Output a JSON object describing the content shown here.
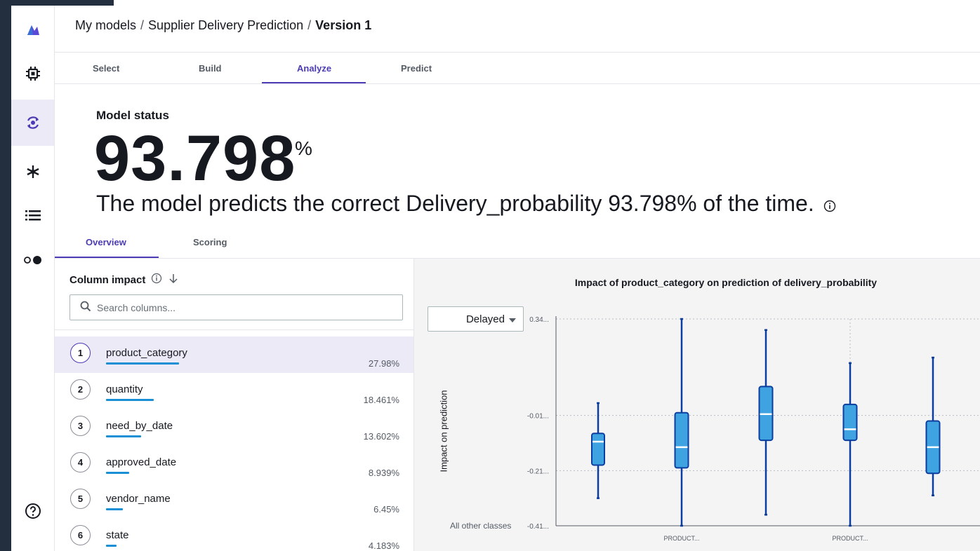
{
  "breadcrumb": {
    "root": "My models",
    "model": "Supplier Delivery Prediction",
    "version": "Version 1",
    "separator": "/"
  },
  "nav_icons": [
    "logo-icon",
    "chip-icon",
    "refresh-icon",
    "network-icon",
    "list-icon",
    "toggle-icon",
    "help-icon"
  ],
  "tabs": [
    "Select",
    "Build",
    "Analyze",
    "Predict"
  ],
  "active_tab": "Analyze",
  "model_status": {
    "label": "Model status",
    "accuracy": "93.798",
    "unit": "%",
    "description": "The model predicts the correct Delivery_probability 93.798% of the time."
  },
  "subtabs": [
    "Overview",
    "Scoring"
  ],
  "active_subtab": "Overview",
  "column_impact": {
    "title": "Column impact",
    "search_placeholder": "Search columns...",
    "rows": [
      {
        "rank": "1",
        "name": "product_category",
        "impact": "27.98%",
        "fraction": 0.2798,
        "selected": true
      },
      {
        "rank": "2",
        "name": "quantity",
        "impact": "18.461%",
        "fraction": 0.18461
      },
      {
        "rank": "3",
        "name": "need_by_date",
        "impact": "13.602%",
        "fraction": 0.13602
      },
      {
        "rank": "4",
        "name": "approved_date",
        "impact": "8.939%",
        "fraction": 0.08939
      },
      {
        "rank": "5",
        "name": "vendor_name",
        "impact": "6.45%",
        "fraction": 0.0645
      },
      {
        "rank": "6",
        "name": "state",
        "impact": "4.183%",
        "fraction": 0.04183
      }
    ]
  },
  "chart": {
    "dropdown_value": "Delayed",
    "other_classes_label": "All other classes"
  },
  "chart_data": {
    "type": "boxplot",
    "title": "Impact of product_category on prediction of delivery_probability",
    "ylabel": "Impact on prediction",
    "ytick_labels": [
      "0.34...",
      "-0.01...",
      "-0.21...",
      "-0.41..."
    ],
    "yticks": [
      0.34,
      -0.01,
      -0.21,
      -0.41
    ],
    "ylim": [
      -0.41,
      0.34
    ],
    "xtick_labels": [
      "PRODUCT...",
      "PRODUCT..."
    ],
    "grid": true,
    "series": [
      {
        "min": -0.31,
        "q1": -0.19,
        "median": -0.105,
        "q3": -0.075,
        "max": 0.035
      },
      {
        "min": -0.41,
        "q1": -0.2,
        "median": -0.125,
        "q3": -0.0,
        "max": 0.34
      },
      {
        "min": -0.37,
        "q1": -0.1,
        "median": -0.005,
        "q3": 0.095,
        "max": 0.3
      },
      {
        "min": -0.41,
        "q1": -0.1,
        "median": -0.06,
        "q3": 0.03,
        "max": 0.18
      },
      {
        "min": -0.3,
        "q1": -0.22,
        "median": -0.125,
        "q3": -0.03,
        "max": 0.2
      }
    ],
    "colors": {
      "box": "#3ea3e0",
      "outline": "#0b3e9e",
      "median": "#ffffff"
    }
  }
}
